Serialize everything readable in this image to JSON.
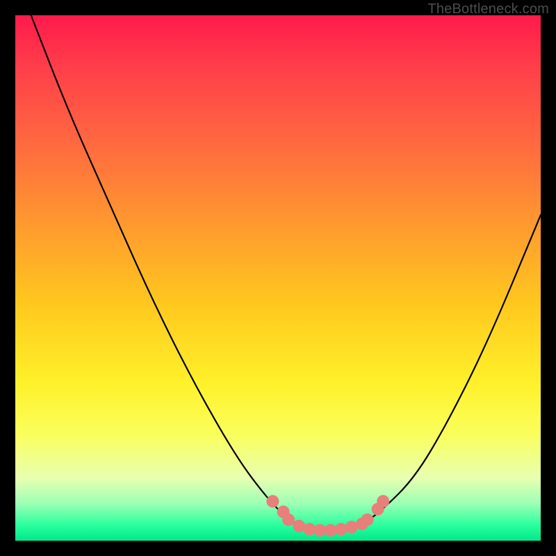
{
  "watermark": "TheBottleneck.com",
  "chart_data": {
    "type": "line",
    "title": "",
    "xlabel": "",
    "ylabel": "",
    "xlim": [
      0,
      100
    ],
    "ylim": [
      0,
      100
    ],
    "grid": false,
    "legend": false,
    "series": [
      {
        "name": "bottleneck-curve",
        "x": [
          3,
          10,
          18,
          26,
          34,
          42,
          48,
          52,
          55,
          58,
          62,
          66,
          70,
          76,
          82,
          90,
          100
        ],
        "y": [
          100,
          82,
          64,
          46,
          30,
          16,
          8,
          4,
          2,
          2,
          2,
          3,
          6,
          12,
          22,
          38,
          62
        ]
      }
    ],
    "markers": {
      "name": "highlight-dots",
      "color": "#e77f7a",
      "points": [
        {
          "x": 49,
          "y": 7.5
        },
        {
          "x": 51,
          "y": 5.5
        },
        {
          "x": 52,
          "y": 4.0
        },
        {
          "x": 54,
          "y": 2.8
        },
        {
          "x": 56,
          "y": 2.2
        },
        {
          "x": 58,
          "y": 2.0
        },
        {
          "x": 60,
          "y": 2.0
        },
        {
          "x": 62,
          "y": 2.2
        },
        {
          "x": 64,
          "y": 2.6
        },
        {
          "x": 66,
          "y": 3.2
        },
        {
          "x": 67,
          "y": 4.0
        },
        {
          "x": 69,
          "y": 6.0
        },
        {
          "x": 70,
          "y": 7.5
        }
      ]
    }
  }
}
